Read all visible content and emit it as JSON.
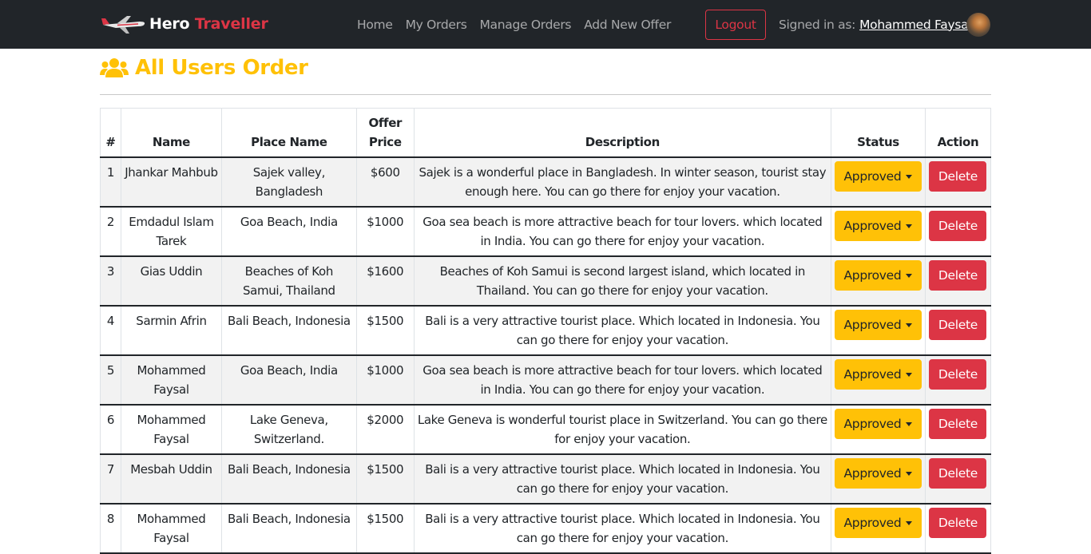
{
  "navbar": {
    "brand_a": "Hero",
    "brand_b": "Traveller",
    "brand_icon": "airplane-icon",
    "links": [
      "Home",
      "My Orders",
      "Manage Orders",
      "Add New Offer"
    ],
    "logout_label": "Logout",
    "signed_in_label": "Signed in as:",
    "user_name": "Mohammed Faysal"
  },
  "page": {
    "title": "All Users Order",
    "title_icon": "users-icon",
    "accent_color": "#ffc107"
  },
  "table": {
    "headers": {
      "num": "#",
      "name": "Name",
      "place": "Place Name",
      "price_1": "Offer",
      "price_2": "Price",
      "description": "Description",
      "status": "Status",
      "action": "Action"
    },
    "rows": [
      {
        "num": "1",
        "name": "Jhankar Mahbub",
        "place": "Sajek valley, Bangladesh",
        "price": "$600",
        "description": "Sajek is a wonderful place in Bangladesh. In winter season, tourist stay enough here. You can go there for enjoy your vacation.",
        "status": "Approved",
        "action": "Delete"
      },
      {
        "num": "2",
        "name": "Emdadul Islam Tarek",
        "place": "Goa Beach, India",
        "price": "$1000",
        "description": "Goa sea beach is more attractive beach for tour lovers. which located in India. You can go there for enjoy your vacation.",
        "status": "Approved",
        "action": "Delete"
      },
      {
        "num": "3",
        "name": "Gias Uddin",
        "place": "Beaches of Koh Samui, Thailand",
        "price": "$1600",
        "description": "Beaches of Koh Samui is second largest island, which located in Thailand. You can go there for enjoy your vacation.",
        "status": "Approved",
        "action": "Delete"
      },
      {
        "num": "4",
        "name": "Sarmin Afrin",
        "place": "Bali Beach, Indonesia",
        "price": "$1500",
        "description": "Bali is a very attractive tourist place. Which located in Indonesia. You can go there for enjoy your vacation.",
        "status": "Approved",
        "action": "Delete"
      },
      {
        "num": "5",
        "name": "Mohammed Faysal",
        "place": "Goa Beach, India",
        "price": "$1000",
        "description": "Goa sea beach is more attractive beach for tour lovers. which located in India. You can go there for enjoy your vacation.",
        "status": "Approved",
        "action": "Delete"
      },
      {
        "num": "6",
        "name": "Mohammed Faysal",
        "place": "Lake Geneva, Switzerland.",
        "price": "$2000",
        "description": "Lake Geneva is wonderful tourist place in Switzerland. You can go there for enjoy your vacation.",
        "status": "Approved",
        "action": "Delete"
      },
      {
        "num": "7",
        "name": "Mesbah Uddin",
        "place": "Bali Beach, Indonesia",
        "price": "$1500",
        "description": "Bali is a very attractive tourist place. Which located in Indonesia. You can go there for enjoy your vacation.",
        "status": "Approved",
        "action": "Delete"
      },
      {
        "num": "8",
        "name": "Mohammed Faysal",
        "place": "Bali Beach, Indonesia",
        "price": "$1500",
        "description": "Bali is a very attractive tourist place. Which located in Indonesia. You can go there for enjoy your vacation.",
        "status": "Approved",
        "action": "Delete"
      }
    ]
  },
  "colors": {
    "navbar_bg": "#212529",
    "danger": "#dc3545",
    "warning": "#ffc107"
  }
}
